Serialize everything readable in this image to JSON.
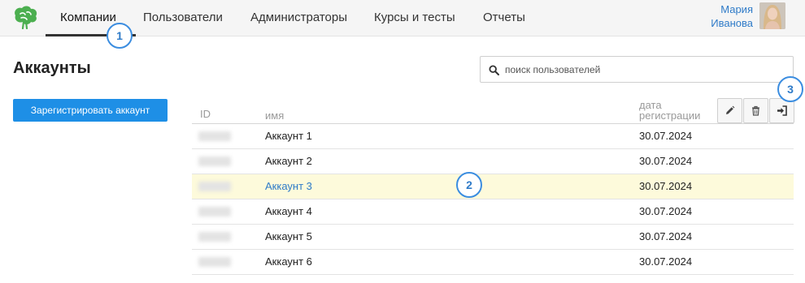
{
  "topbar": {
    "logo_icon": "brain-leaf-logo-icon",
    "nav": [
      {
        "label": "Компании",
        "active": true
      },
      {
        "label": "Пользователи",
        "active": false
      },
      {
        "label": "Администраторы",
        "active": false
      },
      {
        "label": "Курсы и тесты",
        "active": false
      },
      {
        "label": "Отчеты",
        "active": false
      }
    ],
    "user": {
      "first_name": "Мария",
      "last_name": "Иванова",
      "avatar_icon": "user-avatar"
    }
  },
  "page": {
    "title": "Аккаунты",
    "register_button": "Зарегистрировать аккаунт",
    "search": {
      "placeholder": "поиск пользователей",
      "value": "",
      "icon": "search-icon"
    }
  },
  "table": {
    "columns": {
      "id": "ID",
      "name": "имя",
      "date": "дата регистрации"
    },
    "actions": [
      {
        "name": "edit",
        "icon": "pencil-icon"
      },
      {
        "name": "delete",
        "icon": "trash-icon"
      },
      {
        "name": "login",
        "icon": "sign-in-icon"
      }
    ],
    "rows": [
      {
        "name": "Аккаунт 1",
        "date": "30.07.2024",
        "selected": false
      },
      {
        "name": "Аккаунт 2",
        "date": "30.07.2024",
        "selected": false
      },
      {
        "name": "Аккаунт 3",
        "date": "30.07.2024",
        "selected": true
      },
      {
        "name": "Аккаунт 4",
        "date": "30.07.2024",
        "selected": false
      },
      {
        "name": "Аккаунт 5",
        "date": "30.07.2024",
        "selected": false
      },
      {
        "name": "Аккаунт 6",
        "date": "30.07.2024",
        "selected": false
      }
    ]
  },
  "annotations": [
    "1",
    "2",
    "3"
  ],
  "colors": {
    "accent": "#1e8fe6",
    "link": "#2f7bc8",
    "selected_row": "#fdfadb",
    "badge_border": "#3b8de0"
  }
}
